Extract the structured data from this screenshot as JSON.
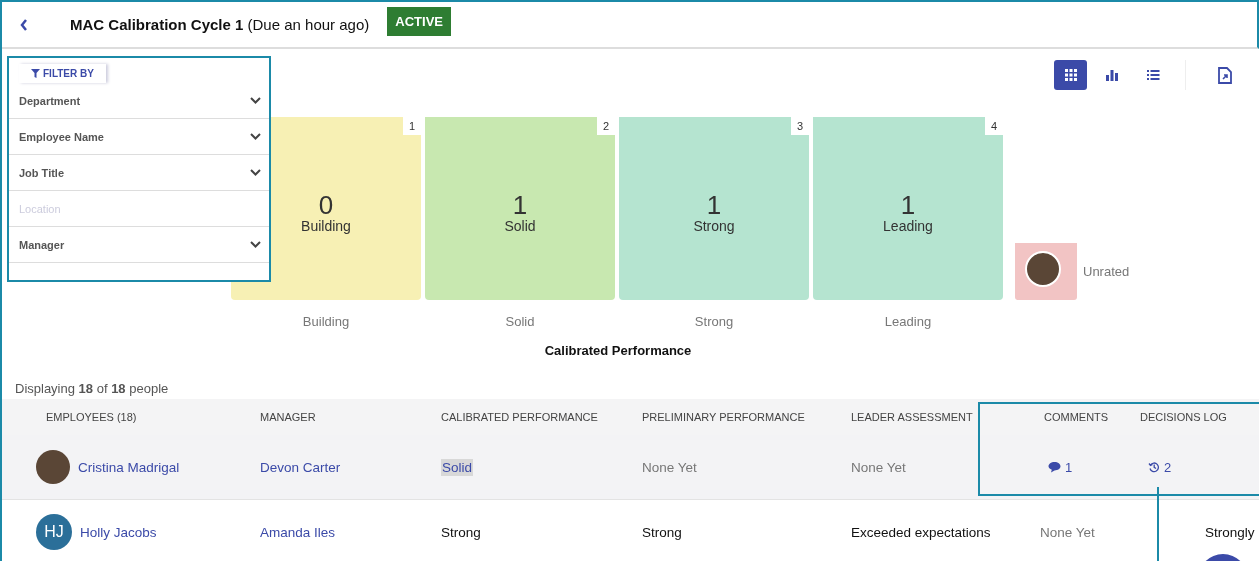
{
  "header": {
    "title": "MAC Calibration Cycle 1",
    "due": "(Due an hour ago)",
    "status": "ACTIVE"
  },
  "filter": {
    "label": "FILTER BY",
    "fields": [
      {
        "label": "Department",
        "disabled": false
      },
      {
        "label": "Employee Name",
        "disabled": false
      },
      {
        "label": "Job Title",
        "disabled": false
      },
      {
        "label": "Location",
        "disabled": true
      },
      {
        "label": "Manager",
        "disabled": false
      }
    ]
  },
  "views": [
    {
      "kind": "grid",
      "selected": true
    },
    {
      "kind": "bars",
      "selected": false
    },
    {
      "kind": "list",
      "selected": false
    }
  ],
  "tiles": [
    {
      "rank": "1",
      "count": "0",
      "label": "Building",
      "color": "#f7f0b4"
    },
    {
      "rank": "2",
      "count": "1",
      "label": "Solid",
      "color": "#c8e8b0"
    },
    {
      "rank": "3",
      "count": "1",
      "label": "Strong",
      "color": "#b5e4d0"
    },
    {
      "rank": "4",
      "count": "1",
      "label": "Leading",
      "color": "#b5e4d0"
    }
  ],
  "unrated": {
    "label": "Unrated",
    "color": "#f2c4c4"
  },
  "axis_labels": [
    "Building",
    "Solid",
    "Strong",
    "Leading"
  ],
  "axis_title": "Calibrated Performance",
  "displaying": "Displaying **18** of **18** people",
  "table": {
    "columns": [
      "EMPLOYEES (18)",
      "MANAGER",
      "CALIBRATED PERFORMANCE",
      "PRELIMINARY PERFORMANCE",
      "LEADER ASSESSMENT",
      "COMMENTS",
      "DECISIONS LOG",
      ""
    ],
    "rows": [
      {
        "cells": [
          {
            "kind": "employee",
            "avatar": {
              "kind": "photo"
            },
            "text": "Cristina Madrigal"
          },
          {
            "kind": "manager",
            "text": "Devon Carter"
          },
          {
            "kind": "link",
            "text": "Solid",
            "highlighted": true
          },
          {
            "kind": "muted",
            "text": "None Yet"
          },
          {
            "kind": "muted",
            "text": "None Yet"
          },
          {
            "kind": "comment",
            "text": "1"
          },
          {
            "kind": "log",
            "text": "2"
          }
        ],
        "shaded": true
      },
      {
        "cells": [
          {
            "kind": "employee",
            "avatar": {
              "kind": "initials",
              "text": "HJ"
            },
            "text": "Holly Jacobs"
          },
          {
            "kind": "manager",
            "text": "Amanda Iles"
          },
          {
            "kind": "text",
            "text": "Strong",
            "highlighted": false
          },
          {
            "kind": "text",
            "text": "Strong"
          },
          {
            "kind": "text",
            "text": "Exceeded expectations"
          },
          {
            "kind": "muted",
            "text": "None Yet"
          },
          {
            "kind": "empty"
          },
          {
            "kind": "text",
            "text": "Strongly"
          }
        ],
        "shaded": false
      }
    ]
  }
}
